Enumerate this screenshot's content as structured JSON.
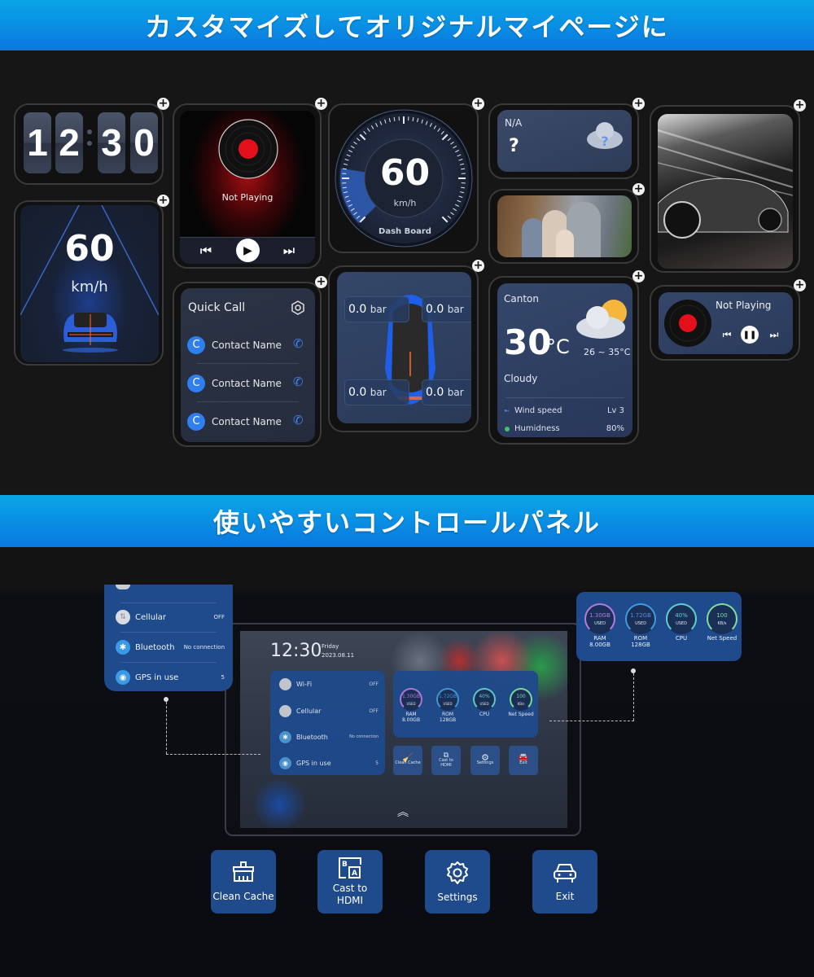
{
  "banners": {
    "top": "カスタマイズしてオリジナルマイページに",
    "middle": "使いやすいコントロールパネル"
  },
  "widgets": {
    "flip_clock": {
      "digits": [
        "1",
        "2",
        "3",
        "0"
      ],
      "time": "12:30"
    },
    "speed_hud": {
      "value": "60",
      "unit": "km/h"
    },
    "music_large": {
      "status": "Not Playing",
      "controls": [
        "previous",
        "play",
        "next"
      ]
    },
    "dashboard": {
      "value": "60",
      "unit": "km/h",
      "label": "Dash Board",
      "gauge_fill_fraction": 0.2
    },
    "weather_na": {
      "location": "N/A",
      "value": "?"
    },
    "photo": {
      "description": "family-photo"
    },
    "car_photo": {
      "description": "sports-car-photo"
    },
    "music_small": {
      "status": "Not Playing",
      "controls": [
        "previous",
        "pause",
        "next"
      ]
    },
    "quick_call": {
      "title": "Quick Call",
      "contacts": [
        {
          "initial": "C",
          "name": "Contact Name"
        },
        {
          "initial": "C",
          "name": "Contact Name"
        },
        {
          "initial": "C",
          "name": "Contact Name"
        }
      ]
    },
    "tire_pressure": {
      "front_left": {
        "value": "0.0",
        "unit": "bar"
      },
      "front_right": {
        "value": "0.0",
        "unit": "bar"
      },
      "rear_left": {
        "value": "0.0",
        "unit": "bar"
      },
      "rear_right": {
        "value": "0.0",
        "unit": "bar"
      }
    },
    "weather": {
      "city": "Canton",
      "temp": "30",
      "temp_unit": "°C",
      "range": "26 ~ 35°C",
      "condition": "Cloudy",
      "wind_label": "Wind speed",
      "wind_value": "Lv 3",
      "humidity_label": "Humidness",
      "humidity_value": "80%"
    }
  },
  "control_panel": {
    "time": "12:30",
    "day": "Friday",
    "date": "2023.08.11",
    "connectivity": [
      {
        "name": "Wi-Fi",
        "status": "OFF"
      },
      {
        "name": "Cellular",
        "status": "OFF"
      },
      {
        "name": "Bluetooth",
        "status": "No connection"
      },
      {
        "name": "GPS in use",
        "status": "5"
      }
    ],
    "meters": [
      {
        "value": "1.30GB",
        "sub": "USED",
        "label": "RAM",
        "label2": "8.00GB",
        "color": "#b47be0"
      },
      {
        "value": "1.72GB",
        "sub": "USED",
        "label": "ROM",
        "label2": "128GB",
        "color": "#3e9be0"
      },
      {
        "value": "40%",
        "sub": "USED",
        "label": "CPU",
        "label2": "",
        "color": "#5fd0d0"
      },
      {
        "value": "100",
        "sub": "KB/s",
        "label": "Net Speed",
        "label2": "",
        "color": "#7ee0a0"
      }
    ],
    "actions": [
      {
        "label": "Clean Cache",
        "icon": "broom-icon"
      },
      {
        "label": "Cast to HDMI",
        "label_line1": "Cast to",
        "label_line2": "HDMI",
        "icon": "cast-hdmi-icon"
      },
      {
        "label": "Settings",
        "icon": "gear-icon"
      },
      {
        "label": "Exit",
        "icon": "car-exit-icon"
      }
    ]
  },
  "colors": {
    "banner_blue": "#0a8ae4",
    "panel_blue": "#1f4a8c",
    "accent_red": "#e3101c",
    "contact_blue": "#2f7ff0"
  }
}
